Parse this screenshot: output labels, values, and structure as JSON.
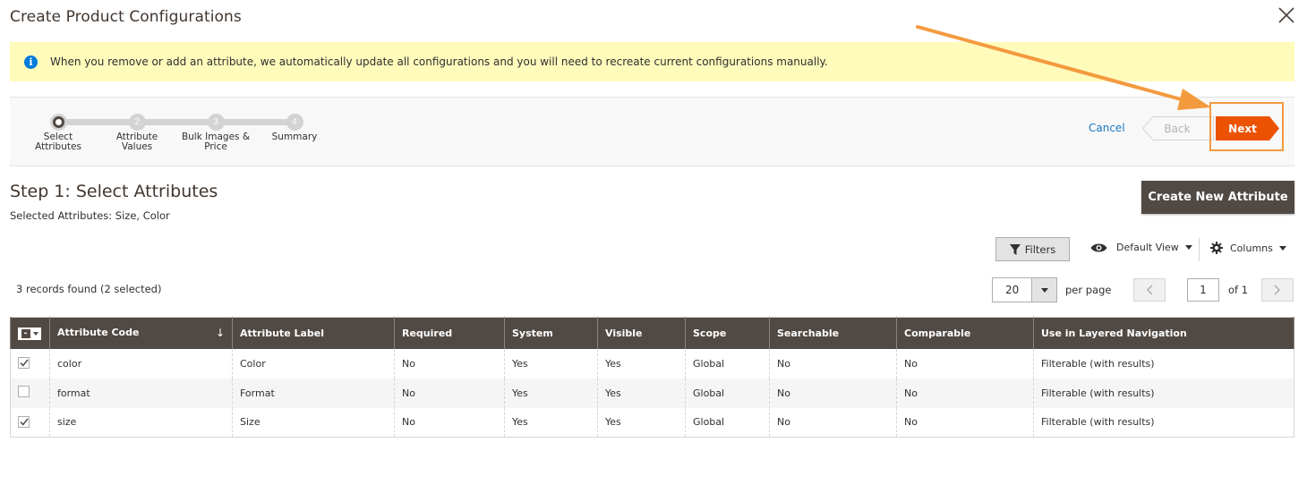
{
  "modal": {
    "title": "Create Product Configurations"
  },
  "notice": {
    "text": "When you remove or add an attribute, we automatically update all configurations and you will need to recreate current configurations manually."
  },
  "wizard": {
    "steps": [
      {
        "number": "1",
        "label_line1": "Select",
        "label_line2": "Attributes",
        "active": true
      },
      {
        "number": "2",
        "label_line1": "Attribute",
        "label_line2": "Values",
        "active": false
      },
      {
        "number": "3",
        "label_line1": "Bulk Images &",
        "label_line2": "Price",
        "active": false
      },
      {
        "number": "4",
        "label_line1": "Summary",
        "label_line2": "",
        "active": false
      }
    ],
    "cancel_label": "Cancel",
    "back_label": "Back",
    "next_label": "Next"
  },
  "step_content": {
    "heading": "Step 1: Select Attributes",
    "selected_text": "Selected Attributes: Size, Color",
    "create_button_label": "Create New Attribute"
  },
  "toolbar": {
    "filters_label": "Filters",
    "view_label": "Default View",
    "columns_label": "Columns",
    "records_found": "3 records found (2 selected)",
    "page_size": "20",
    "per_page_label": "per page",
    "current_page": "1",
    "of_pages": "of 1"
  },
  "grid": {
    "columns": [
      "Attribute Code",
      "Attribute Label",
      "Required",
      "System",
      "Visible",
      "Scope",
      "Searchable",
      "Comparable",
      "Use in Layered Navigation"
    ],
    "sort_indicator": "↓",
    "rows": [
      {
        "checked": true,
        "cells": [
          "color",
          "Color",
          "No",
          "Yes",
          "Yes",
          "Global",
          "No",
          "No",
          "Filterable (with results)"
        ]
      },
      {
        "checked": false,
        "cells": [
          "format",
          "Format",
          "No",
          "Yes",
          "Yes",
          "Global",
          "No",
          "No",
          "Filterable (with results)"
        ]
      },
      {
        "checked": true,
        "cells": [
          "size",
          "Size",
          "No",
          "Yes",
          "Yes",
          "Global",
          "No",
          "No",
          "Filterable (with results)"
        ]
      }
    ]
  },
  "colors": {
    "accent_next": "#eb5202",
    "header_dark": "#514943",
    "link_blue": "#1979c3",
    "notice_bg": "#fffbbb",
    "annotation_arrow": "#f39a3f"
  }
}
